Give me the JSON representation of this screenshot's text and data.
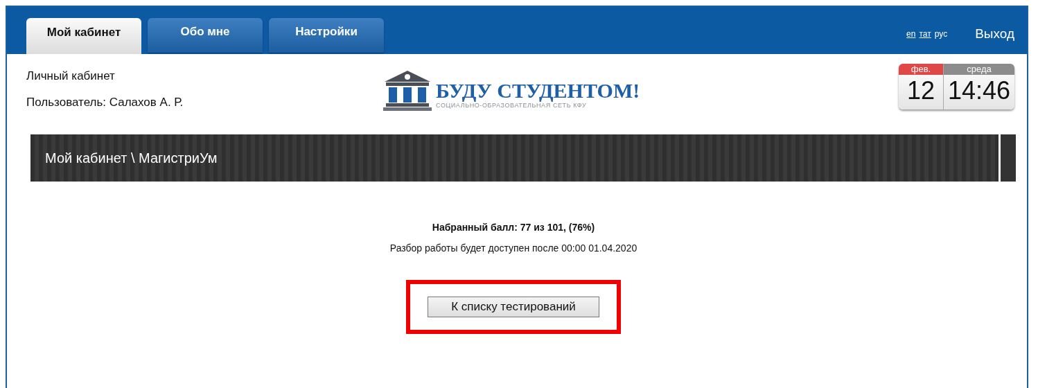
{
  "tabs": [
    {
      "label": "Мой кабинет",
      "selected": true
    },
    {
      "label": "Обо мне",
      "selected": false
    },
    {
      "label": "Настройки",
      "selected": false
    }
  ],
  "languages": [
    {
      "label": "en",
      "selected": false
    },
    {
      "label": "тат",
      "selected": false
    },
    {
      "label": "рус",
      "selected": true
    }
  ],
  "logout": "Выход",
  "user": {
    "title": "Личный кабинет",
    "name": "Пользователь: Салахов А. Р."
  },
  "logo": {
    "title": "БУДУ СТУДЕНТОМ!",
    "subtitle": "СОЦИАЛЬНО-ОБРАЗОВАТЕЛЬНАЯ СЕТЬ КФУ"
  },
  "calendar": {
    "month": "фев.",
    "day": "12",
    "weekday": "среда",
    "time": "14:46"
  },
  "breadcrumb": "Мой кабинет \\ МагистриУм",
  "result": {
    "score": "Набранный балл: 77 из 101, (76%)",
    "note": "Разбор работы будет доступен после 00:00 01.04.2020"
  },
  "button": {
    "label": "К списку тестирований",
    "highlighted": true
  }
}
